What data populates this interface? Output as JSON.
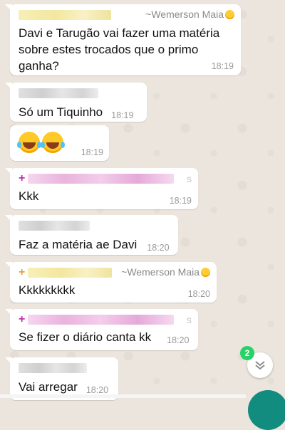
{
  "messages": [
    {
      "sender_alias": "~Wemerson Maia",
      "text": "Davi e Tarugão vai fazer uma matéria sobre estes trocados que o primo ganha?",
      "time": "18:19"
    },
    {
      "text": "Só um Tiquinho",
      "time": "18:19"
    },
    {
      "emojis": [
        "joy-emoji",
        "joy-emoji"
      ],
      "time": "18:19"
    },
    {
      "sender_suffix": "s",
      "text": "Kkk",
      "time": "18:19"
    },
    {
      "text": "Faz a matéria ae Davi",
      "time": "18:20"
    },
    {
      "sender_alias": "~Wemerson Maia",
      "text": "Kkkkkkkkk",
      "time": "18:20"
    },
    {
      "sender_suffix": "s",
      "text": "Se fizer o diário canta kk",
      "time": "18:20"
    },
    {
      "text": "Vai arregar",
      "time": "18:20"
    }
  ],
  "scroll_button": {
    "unread_count": "2",
    "icon": "double-chevron-down-icon"
  },
  "colors": {
    "chat_bg": "#ece5dd",
    "bubble": "#ffffff",
    "badge": "#25d366",
    "fab": "#128c7e"
  }
}
